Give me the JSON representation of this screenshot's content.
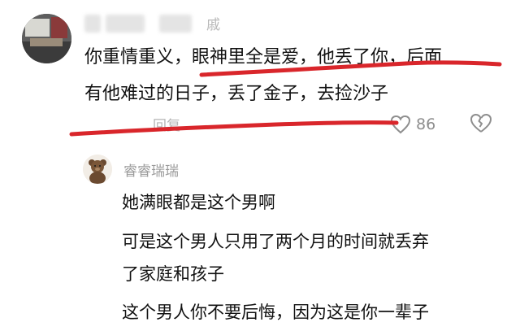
{
  "comment1": {
    "username_visible": "戚",
    "lines": [
      "你重情重义，眼神里全是爱，他丢了你，后面",
      "有他难过的日子，丢了金子，去捡沙子"
    ],
    "reply_label": "回复",
    "like_count": "86",
    "icons": [
      "heart-outline-icon",
      "broken-heart-icon"
    ],
    "annotation_color": "#d9262b"
  },
  "comment2": {
    "username": "睿睿瑞瑞",
    "lines": [
      "她满眼都是这个男啊",
      "可是这个男人只用了两个月的时间就丢弃",
      "了家庭和孩子",
      "这个男人你不要后悔，因为这是你一辈子"
    ]
  }
}
